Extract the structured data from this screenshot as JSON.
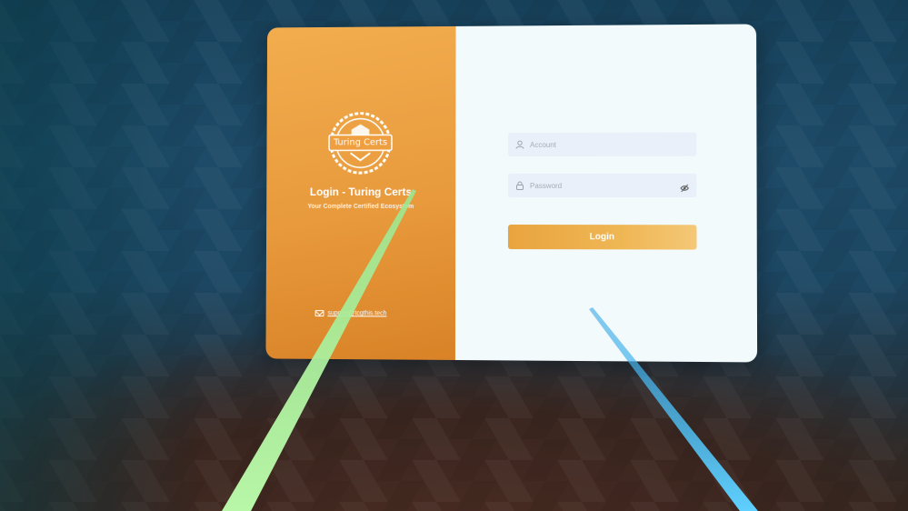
{
  "brand": {
    "logo_text": "Turing Certs",
    "title": "Login - Turing Certs",
    "subtitle": "Your Complete Certified Ecosystem",
    "email": "support@tcgthis.tech",
    "color_primary": "#e89a3c"
  },
  "form": {
    "account_placeholder": "Account",
    "account_value": "",
    "password_placeholder": "Password",
    "password_value": "",
    "login_label": "Login",
    "button_color": "#efb654"
  },
  "icons": {
    "account": "user-icon",
    "password": "lock-icon",
    "reveal": "eye-icon",
    "email": "mail-icon"
  },
  "pointers": {
    "left_color": "#a8f0a0",
    "right_color": "#4fc3f7"
  }
}
